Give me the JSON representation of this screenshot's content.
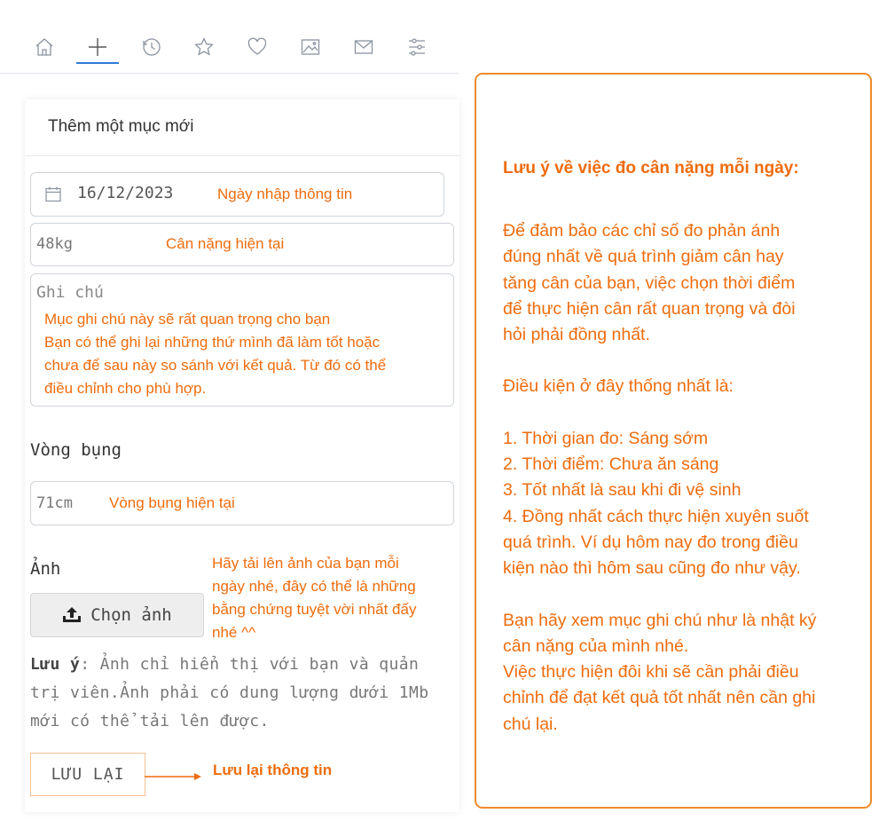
{
  "nav": {
    "icons": [
      "home-icon",
      "plus-icon",
      "history-icon",
      "star-icon",
      "heart-icon",
      "image-icon",
      "mail-icon",
      "settings-sliders-icon"
    ],
    "active": "plus-icon"
  },
  "form": {
    "title": "Thêm một mục mới",
    "date_value": "16/12/2023",
    "date_note": "Ngày nhập thông tin",
    "weight_value": "48kg",
    "weight_note": "Cân nặng hiện tại",
    "notes_placeholder": "Ghi chú",
    "notes_annotation": [
      "Mục ghi chú này sẽ rất quan trọng cho bạn",
      "Bạn có thể ghi lại những thứ mình đã làm tốt hoặc",
      "chưa để sau này so sánh với kết quả. Từ đó có thể",
      "điều chỉnh cho phù hợp."
    ],
    "waist_label": "Vòng bụng",
    "waist_value": "71cm",
    "waist_note": "Vòng bụng hiện tại",
    "photo_label": "Ảnh",
    "photo_note": [
      "Hãy tải lên ảnh của bạn mỗi",
      "ngày nhé, đây có thể là những",
      "bằng chứng tuyệt vời nhất đấy",
      "nhé ^^"
    ],
    "upload_button": "Chọn ảnh",
    "warning_bold": "Lưu ý",
    "warning_text": ": Ảnh chỉ hiển thị với bạn và quản trị viên.Ảnh phải có dung lượng dưới 1Mb mới có thể tải lên được.",
    "save_button": "LƯU LẠI",
    "save_note": "Lưu lại thông tin"
  },
  "info": {
    "title": "Lưu ý về việc đo cân nặng mỗi ngày:",
    "intro": [
      "Để đảm bảo các chỉ số đo phản ánh",
      "đúng nhất về quá trình giảm cân hay",
      "tăng cân của bạn, việc chọn thời điểm",
      "để thực hiện cân rất quan trọng và đòi",
      "hỏi phải đồng nhất."
    ],
    "conditions_title": "Điều kiện ở đây thống nhất là:",
    "conditions": [
      "1. Thời gian đo: Sáng sớm",
      "2. Thời điểm: Chưa ăn sáng",
      "3. Tốt nhất là sau khi đi vệ sinh",
      "4. Đồng nhất cách thực hiện xuyên suốt",
      "quá trình. Ví dụ hôm nay đo trong điều",
      "kiện nào thì hôm sau cũng đo như vậy."
    ],
    "closing": [
      "Bạn hãy xem mục ghi chú như là nhật ký",
      "cân nặng của mình nhé.",
      "Việc thực hiện đôi khi sẽ cần phải điều",
      "chỉnh để đạt kết quả tốt nhất nên cần ghi",
      "chú lại."
    ]
  },
  "colors": {
    "accent": "#ee6c0e",
    "nav_active": "#2f7bd6",
    "icon": "#8a93a0"
  }
}
